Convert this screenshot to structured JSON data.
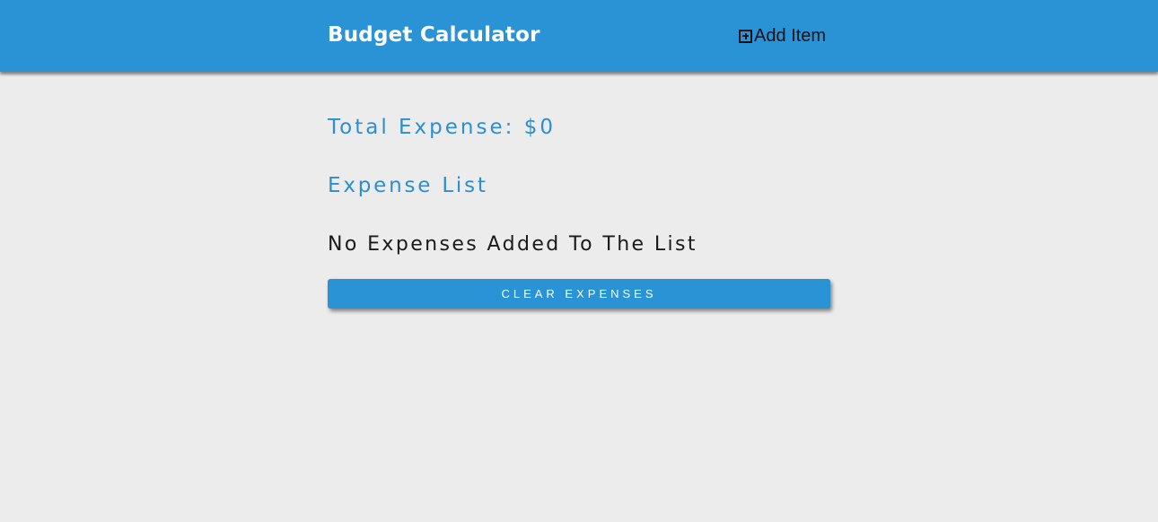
{
  "header": {
    "title": "Budget Calculator",
    "add_item_label": "Add Item",
    "add_item_icon": "plus-square-icon"
  },
  "summary": {
    "total_expense": "Total Expense: $0"
  },
  "list": {
    "title": "Expense List",
    "empty_message": "No Expenses Added To The List"
  },
  "actions": {
    "clear_label": "CLEAR EXPENSES"
  },
  "colors": {
    "accent": "#2993d6",
    "background": "#ececec",
    "text_dark": "#1a1a1a",
    "text_light": "#ffffff"
  }
}
